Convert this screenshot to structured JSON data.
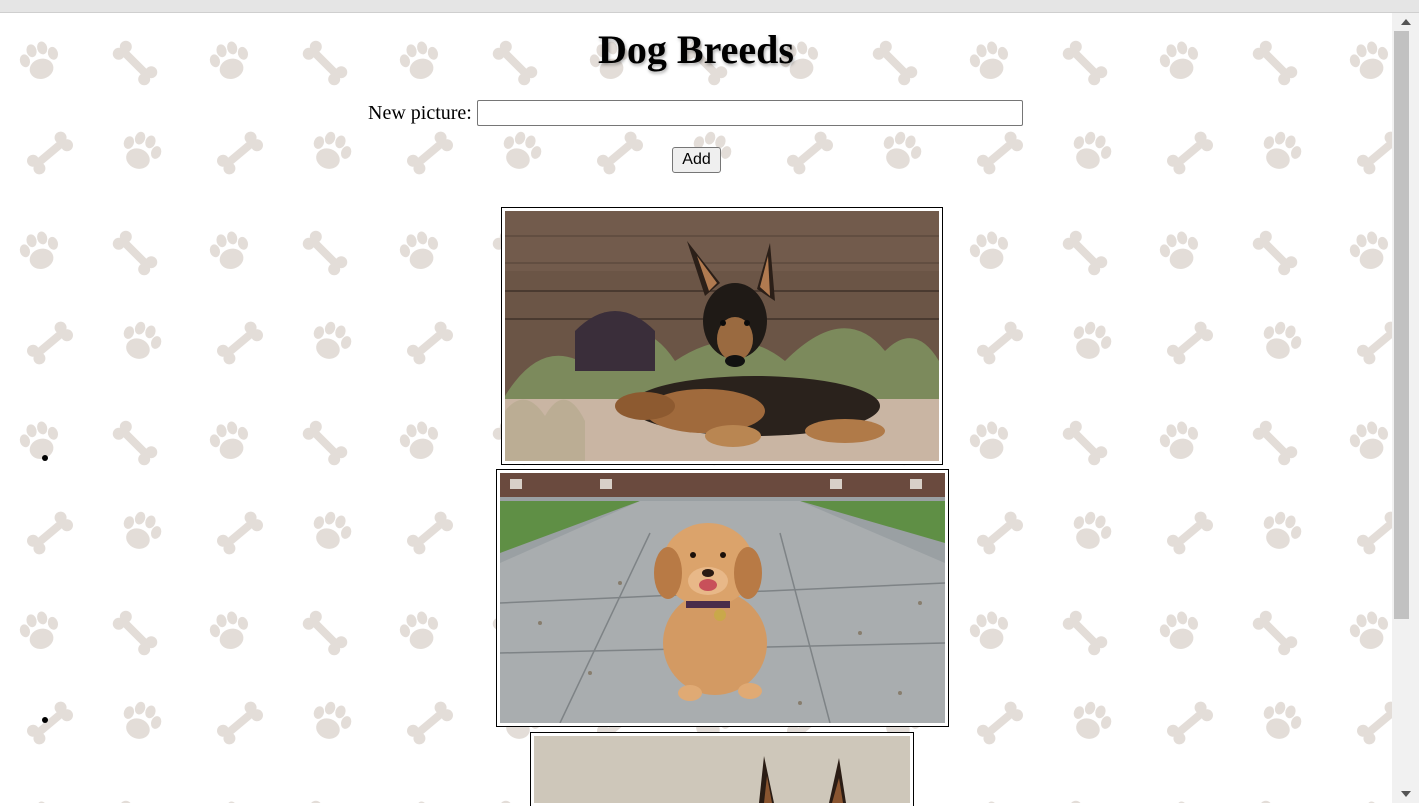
{
  "page": {
    "title": "Dog Breeds",
    "form": {
      "label": "New picture:",
      "input_value": "",
      "button_label": "Add"
    }
  },
  "pictures": [
    {
      "subject": "german-shepherd-puppy"
    },
    {
      "subject": "golden-retriever-puppy"
    },
    {
      "subject": "doberman-partial"
    }
  ],
  "colors": {
    "pattern": "#e3ddd8",
    "frame_border": "#000000",
    "scrollbar_thumb": "#c1c1c1"
  },
  "icons": [
    "paw-print-icon",
    "bone-icon"
  ]
}
